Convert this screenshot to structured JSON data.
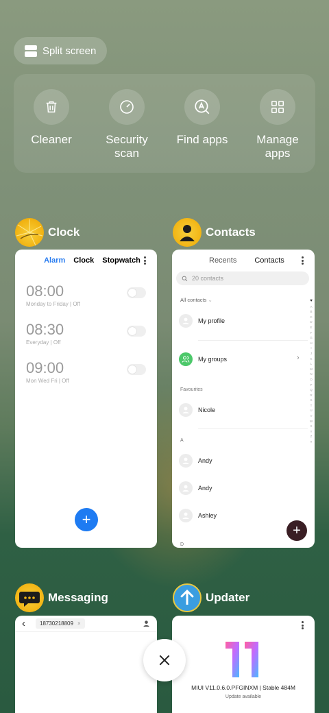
{
  "split_screen": {
    "label": "Split screen",
    "icon": "split-screen-icon"
  },
  "tools": [
    {
      "label": "Cleaner",
      "icon": "trash-icon"
    },
    {
      "label": "Security\nscan",
      "icon": "security-scan-icon"
    },
    {
      "label": "Find apps",
      "icon": "find-apps-icon"
    },
    {
      "label": "Manage\napps",
      "icon": "grid-icon"
    }
  ],
  "clock": {
    "app_name": "Clock",
    "tabs": [
      "Alarm",
      "Clock",
      "Stopwatch"
    ],
    "active_tab": "Alarm",
    "alarms": [
      {
        "time": "08:00",
        "sub": "Monday to Friday | Off",
        "on": false
      },
      {
        "time": "08:30",
        "sub": "Everyday | Off",
        "on": false
      },
      {
        "time": "09:00",
        "sub": "Mon Wed Fri | Off",
        "on": false
      }
    ],
    "fab": "+",
    "accent": "#1e7bf2"
  },
  "contacts": {
    "app_name": "Contacts",
    "tabs": [
      "Recents",
      "Contacts"
    ],
    "active_tab": "Contacts",
    "search_placeholder": "20 contacts",
    "filter": "All contacts",
    "my_profile": "My profile",
    "my_groups": "My groups",
    "favourites_label": "Favourites",
    "favourites": [
      "Nicole"
    ],
    "section_a": "A",
    "section_a_names": [
      "Andy",
      "Andy",
      "Ashley"
    ],
    "section_d": "D",
    "alphabet": [
      "♥",
      "A",
      "B",
      "C",
      "D",
      "E",
      "F",
      "G",
      "H",
      "I",
      "J",
      "K",
      "L",
      "M",
      "N",
      "O",
      "P",
      "Q",
      "R",
      "S",
      "T",
      "U",
      "V",
      "W",
      "X",
      "Y",
      "Z",
      "#"
    ],
    "fab": "+",
    "fab_color": "#3a1e24"
  },
  "messaging": {
    "app_name": "Messaging",
    "recipient": "18730218809"
  },
  "updater": {
    "app_name": "Updater",
    "version": "MIUI V11.0.6.0.PFGINXM | Stable 484M",
    "status": "Update available"
  },
  "close": {
    "icon": "close-icon"
  }
}
